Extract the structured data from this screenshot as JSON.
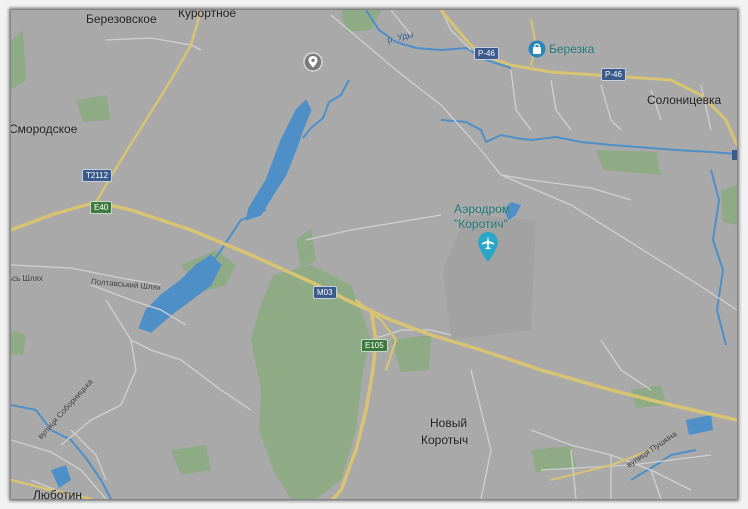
{
  "places": {
    "berezovskoe": "Березовское",
    "kurortnoe": "Курортное",
    "smorodskoe": "Смородское",
    "solonitsevka": "Солоницевка",
    "novy": "Новый",
    "korotych": "Коротыч",
    "lyubotin": "Люботин"
  },
  "poi": {
    "airfield_line1": "Аэродром",
    "airfield_line2": "\"Коротич\"",
    "store": "Березка"
  },
  "rivers": {
    "udy": "р. Уды"
  },
  "roads": {
    "t2112": "Т2112",
    "e40": "E40",
    "m03": "M03",
    "e105": "E105",
    "r46_top": "Р-46",
    "r46_right": "Р-46"
  },
  "streets": {
    "shlyakh_cut": "ьсь Шлях",
    "poltavsky": "Полтавський Шлях",
    "sobornicka": "вулиця Соборницька",
    "pushkina": "вулиця Пушкіна"
  },
  "colors": {
    "land": "#a9a9a9",
    "park": "#8fab86",
    "water": "#4f8fc8",
    "highway": "#d8c373",
    "road": "#d0d0d0",
    "poi_text": "#20777a"
  },
  "icons": {
    "pin": "map-pin-icon",
    "airport": "airplane-icon",
    "shop": "shopping-bag-icon"
  }
}
